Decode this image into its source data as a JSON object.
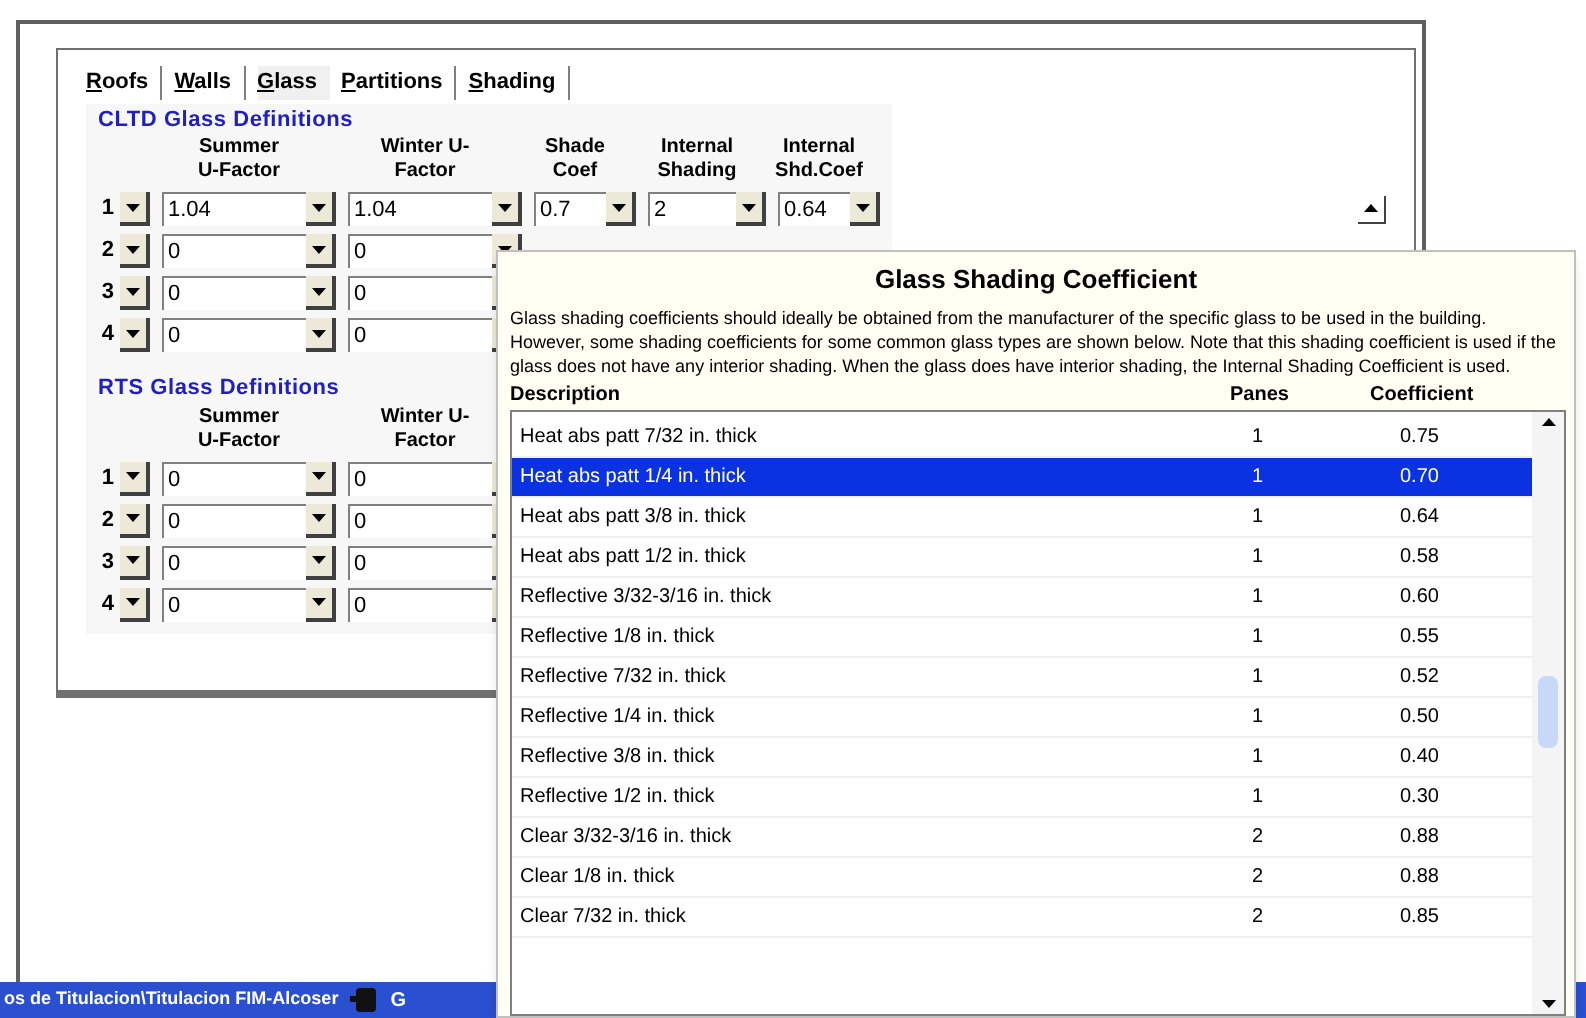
{
  "tabs": [
    {
      "label": "Roofs",
      "selected": false
    },
    {
      "label": "Walls",
      "selected": false
    },
    {
      "label": "Glass",
      "selected": true
    },
    {
      "label": "Partitions",
      "selected": false
    },
    {
      "label": "Shading",
      "selected": false
    }
  ],
  "cltd": {
    "title": "CLTD Glass Definitions",
    "columns": [
      "Summer U-Factor",
      "Winter U-Factor",
      "Shade Coef",
      "Internal Shading",
      "Internal Shd.Coef"
    ],
    "rows": [
      {
        "number": "1",
        "values": [
          "1.04",
          "1.04",
          "0.7",
          "2",
          "0.64"
        ]
      },
      {
        "number": "2",
        "values": [
          "0",
          "0"
        ]
      },
      {
        "number": "3",
        "values": [
          "0",
          "0"
        ]
      },
      {
        "number": "4",
        "values": [
          "0",
          "0"
        ]
      }
    ]
  },
  "rts": {
    "title": "RTS Glass Definitions",
    "columns": [
      "Summer U-Factor",
      "Winter U-Factor"
    ],
    "rows": [
      {
        "number": "1",
        "values": [
          "0",
          "0"
        ]
      },
      {
        "number": "2",
        "values": [
          "0",
          "0"
        ]
      },
      {
        "number": "3",
        "values": [
          "0",
          "0"
        ]
      },
      {
        "number": "4",
        "values": [
          "0",
          "0"
        ]
      }
    ]
  },
  "popup": {
    "title": "Glass Shading Coefficient",
    "text": "Glass shading coefficients should ideally be obtained from the manufacturer of the specific glass to be used in the building.  However, some shading coefficients for some common glass types are shown below.  Note that this shading coefficient is used if the glass does not have any interior shading.  When the glass does have interior shading, the Internal Shading Coefficient is used.",
    "columns": [
      "Description",
      "Panes",
      "Coefficient"
    ],
    "rows": [
      {
        "description": "Heat abs patt 7/32 in. thick",
        "panes": "1",
        "coefficient": "0.75",
        "selected": false
      },
      {
        "description": "Heat abs patt 1/4 in. thick",
        "panes": "1",
        "coefficient": "0.70",
        "selected": true
      },
      {
        "description": "Heat abs patt 3/8 in. thick",
        "panes": "1",
        "coefficient": "0.64",
        "selected": false
      },
      {
        "description": "Heat abs patt 1/2 in. thick",
        "panes": "1",
        "coefficient": "0.58",
        "selected": false
      },
      {
        "description": "Reflective 3/32-3/16 in. thick",
        "panes": "1",
        "coefficient": "0.60",
        "selected": false
      },
      {
        "description": "Reflective 1/8 in. thick",
        "panes": "1",
        "coefficient": "0.55",
        "selected": false
      },
      {
        "description": "Reflective 7/32 in. thick",
        "panes": "1",
        "coefficient": "0.52",
        "selected": false
      },
      {
        "description": "Reflective 1/4 in. thick",
        "panes": "1",
        "coefficient": "0.50",
        "selected": false
      },
      {
        "description": "Reflective 3/8 in. thick",
        "panes": "1",
        "coefficient": "0.40",
        "selected": false
      },
      {
        "description": "Reflective 1/2 in. thick",
        "panes": "1",
        "coefficient": "0.30",
        "selected": false
      },
      {
        "description": "Clear 3/32-3/16 in. thick",
        "panes": "2",
        "coefficient": "0.88",
        "selected": false
      },
      {
        "description": "Clear 1/8 in. thick",
        "panes": "2",
        "coefficient": "0.88",
        "selected": false
      },
      {
        "description": "Clear 7/32 in. thick",
        "panes": "2",
        "coefficient": "0.85",
        "selected": false
      }
    ]
  },
  "taskbar": {
    "path": "os de Titulacion\\Titulacion FIM-Alcoser",
    "item": "G"
  }
}
